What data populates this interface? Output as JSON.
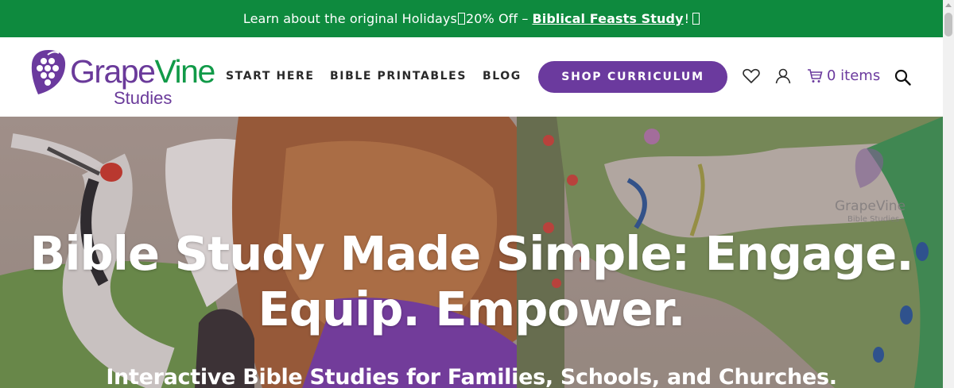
{
  "announcement": {
    "text": "Learn about the original Holidays",
    "discount": "20% Off – ",
    "link_label": "Biblical Feasts Study",
    "suffix": "!"
  },
  "header": {
    "logo": {
      "word1": "Grape",
      "word2": "Vine",
      "word3": "Studies"
    },
    "nav": [
      "START HERE",
      "BIBLE PRINTABLES",
      "BLOG"
    ],
    "cta_label": "SHOP CURRICULUM",
    "cart_label": "0 items",
    "icons": [
      "heart-icon",
      "user-icon",
      "cart-icon",
      "search-icon"
    ]
  },
  "hero": {
    "title_line1": "Bible Study Made Simple: Engage.",
    "title_line2": "Equip. Empower.",
    "subtitle": "Interactive Bible Studies for Families, Schools, and Churches.",
    "watermark": {
      "word1": "GrapeVine",
      "word2": "Bible Studies"
    }
  },
  "colors": {
    "announcement_bg": "#0e8a3e",
    "brand_purple": "#6b3a9e",
    "brand_green": "#119a48"
  }
}
